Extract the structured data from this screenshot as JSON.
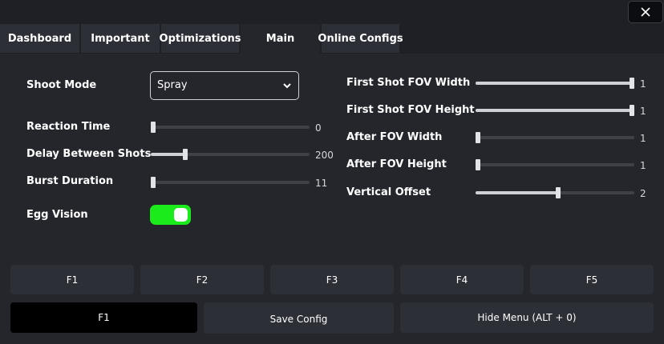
{
  "window": {
    "corner_glyph": "´",
    "close_icon": "close-icon"
  },
  "tabs": [
    {
      "label": "Dashboard",
      "active": false
    },
    {
      "label": "Important",
      "active": false
    },
    {
      "label": "Optimizations",
      "active": false
    },
    {
      "label": "Main",
      "active": true
    },
    {
      "label": "Online Configs",
      "active": false
    }
  ],
  "left_panel": {
    "shoot_mode": {
      "label": "Shoot Mode",
      "value": "Spray"
    },
    "sliders": [
      {
        "label": "Reaction Time",
        "value": "0",
        "fraction": 0.0
      },
      {
        "label": "Delay Between Shots",
        "value": "200",
        "fraction": 0.21
      },
      {
        "label": "Burst Duration",
        "value": "11",
        "fraction": 0.0
      }
    ],
    "egg_vision": {
      "label": "Egg Vision",
      "enabled": true
    }
  },
  "right_panel": {
    "sliders": [
      {
        "label": "First Shot FOV Width",
        "value": "1",
        "fraction": 1.0
      },
      {
        "label": "First Shot FOV Height",
        "value": "1",
        "fraction": 1.0
      },
      {
        "label": "After FOV Width",
        "value": "1",
        "fraction": 0.0
      },
      {
        "label": "After FOV Height",
        "value": "1",
        "fraction": 0.0
      },
      {
        "label": "Vertical Offset",
        "value": "2",
        "fraction": 0.52
      }
    ]
  },
  "config_slots": [
    "F1",
    "F2",
    "F3",
    "F4",
    "F5"
  ],
  "bottom_bar": {
    "selected_config": "F1",
    "save_label": "Save Config",
    "hide_label": "Hide Menu (ALT + 0)"
  },
  "colors": {
    "background": "#24262c",
    "tab": "#2c2f36",
    "toggle_on": "#1bea1b",
    "slider_fill": "#cfd1d6"
  }
}
